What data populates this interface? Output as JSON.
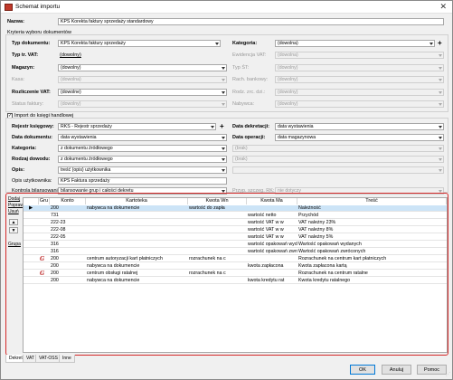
{
  "window": {
    "title": "Schemat importu"
  },
  "nazwa": {
    "label": "Nazwa:",
    "value": "KPS Korekta faktury sprzedaży standardowy"
  },
  "kryteria": {
    "section_label": "Kryteria wyboru dokumentów",
    "typ_dokumentu": {
      "label": "Typ dokumentu:",
      "value": "KPS Korekta faktury sprzedaży"
    },
    "kategoria": {
      "label": "Kategoria:",
      "value": "(dowolna)"
    },
    "typ_tr_vat": {
      "label": "Typ tr. VAT:",
      "value": "(dowolny)"
    },
    "ewidencja_vat": {
      "label": "Ewidencja VAT:",
      "value": "(dowolna)"
    },
    "magazyn": {
      "label": "Magazyn:",
      "value": "(dowolny)"
    },
    "typ_st": {
      "label": "Typ ŚT:",
      "value": "(dowolny)"
    },
    "kasa": {
      "label": "Kasa:",
      "value": "(dowolna)"
    },
    "rach_bankowy": {
      "label": "Rach. bankowy:",
      "value": "(dowolny)"
    },
    "rozliczenie_vat": {
      "label": "Rozliczenie VAT:",
      "value": "(dowolne)"
    },
    "rodz_zrc_dzi": {
      "label": "Rodz. zrc. dzi.:",
      "value": "(dowolny)"
    },
    "status_faktury": {
      "label": "Status faktury:",
      "value": "(dowolny)"
    },
    "nabywca": {
      "label": "Nabywca:",
      "value": "(dowolny)"
    }
  },
  "import": {
    "checkbox_label": "Import do księgi handlowej",
    "checked": true,
    "rejestr_ksiegowy": {
      "label": "Rejestr księgowy:",
      "value": "RKS - Rejestr sprzedaży"
    },
    "data_dekretacji": {
      "label": "Data dekretacji:",
      "value": "data wystawienia"
    },
    "data_dokumentu": {
      "label": "Data dokumentu:",
      "value": "data wystawienia"
    },
    "data_operacji": {
      "label": "Data operacji:",
      "value": "data magazynowa"
    },
    "kategoria": {
      "label": "Kategoria:",
      "value": "z dokumentu źródłowego"
    },
    "kategoria_right": {
      "value": "(brak)"
    },
    "rodzaj_dowodu": {
      "label": "Rodzaj dowodu:",
      "value": "z dokumentu źródłowego"
    },
    "rodzaj_right": {
      "value": "(brak)"
    },
    "opis": {
      "label": "Opis:",
      "value": "treść (opis) użytkownika"
    },
    "opis_right": {
      "value": ""
    },
    "opis_uzytkownika": {
      "label": "Opis użytkownika:",
      "value": "KPS Faktura sprzedaży"
    },
    "kontrola_bilansowania": {
      "label": "Kontrola bilansowania:",
      "value": "bilansowanie grup i całości dekretu"
    },
    "przyp_szczeg_rk": {
      "label": "Przyp. szczeg. RK:",
      "value": "nie dotyczy"
    }
  },
  "side": {
    "dodaj": "Dodaj",
    "popraw": "Popraw",
    "usun": "Usuń",
    "grupa": "Grupa"
  },
  "grid": {
    "columns": [
      "Gru",
      "Konto",
      "Kartoteka",
      "Kwota Wn",
      "Kwota Ma",
      "Treść"
    ],
    "rows": [
      {
        "g": "",
        "konto": "200",
        "kartoteka": "nabywca na dokumencie",
        "wn": "wartość do zapła",
        "ma": "",
        "tresc": "Należność",
        "selected": true
      },
      {
        "g": "",
        "konto": "731",
        "kartoteka": "",
        "wn": "",
        "ma": "wartość netto",
        "tresc": "Przychód"
      },
      {
        "g": "",
        "konto": "222-23",
        "kartoteka": "",
        "wn": "",
        "ma": "wartość VAT w w",
        "tresc": "VAT należny 23%"
      },
      {
        "g": "",
        "konto": "222-08",
        "kartoteka": "",
        "wn": "",
        "ma": "wartość VAT w w",
        "tresc": "VAT należny 8%"
      },
      {
        "g": "",
        "konto": "222-05",
        "kartoteka": "",
        "wn": "",
        "ma": "wartość VAT w w",
        "tresc": "VAT należny 5%"
      },
      {
        "g": "",
        "konto": "316",
        "kartoteka": "",
        "wn": "",
        "ma": "wartość opakowań wydanych",
        "tresc": "Wartość opakowań wydanych"
      },
      {
        "g": "",
        "konto": "316",
        "kartoteka": "",
        "wn": "",
        "ma": "wartość opakowań zwróconych",
        "tresc": "Wartość opakowań zwróconych"
      },
      {
        "g": "G",
        "konto": "200",
        "kartoteka": "centrum autoryzacji kart płatniczych",
        "wn": "rozrachunek na c",
        "ma": "",
        "tresc": "Rozrachunek na centrum kart płatniczych"
      },
      {
        "g": "",
        "konto": "200",
        "kartoteka": "nabywca na dokumencie",
        "wn": "",
        "ma": "kwota zapłacona",
        "tresc": "Kwota zapłacona kartą"
      },
      {
        "g": "G",
        "konto": "200",
        "kartoteka": "centrum obsługi ratalnej",
        "wn": "rozrachunek na c",
        "ma": "",
        "tresc": "Rozrachunek na centrum ratalne"
      },
      {
        "g": "",
        "konto": "200",
        "kartoteka": "nabywca na dokumencie",
        "wn": "",
        "ma": "kwota kredytu rat",
        "tresc": "Kwota kredytu ratalnego"
      }
    ]
  },
  "tabs": [
    "Dekret",
    "VAT",
    "VAT-OSS",
    "Inne"
  ],
  "buttons": {
    "ok": "OK",
    "anuluj": "Anuluj",
    "pomoc": "Pomoc"
  }
}
